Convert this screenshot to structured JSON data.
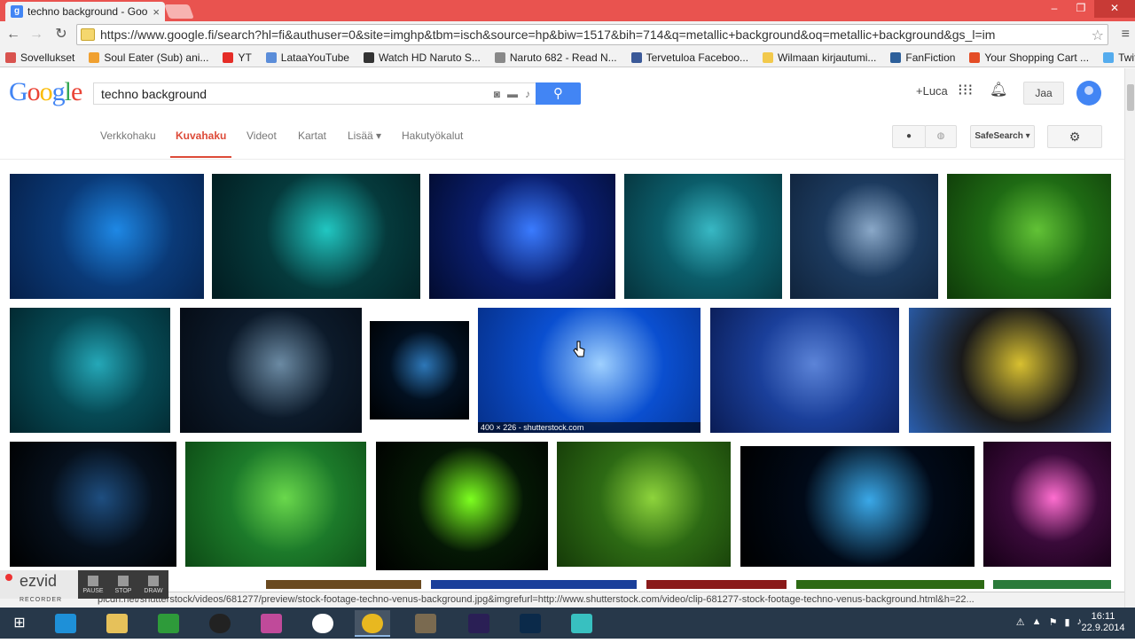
{
  "browser": {
    "tab_title": "techno background - Goo",
    "tab_close": "×",
    "window_buttons": [
      "–",
      "❐",
      "✕"
    ],
    "url": "https://www.google.fi/search?hl=fi&authuser=0&site=imghp&tbm=isch&source=hp&biw=1517&bih=714&q=metallic+background&oq=metallic+background&gs_l=im",
    "bookmarks": [
      {
        "label": "Sovellukset",
        "color": "#d9534f"
      },
      {
        "label": "Soul Eater (Sub) ani...",
        "color": "#f0a030"
      },
      {
        "label": "YT",
        "color": "#e52d27"
      },
      {
        "label": "LataaYouTube",
        "color": "#5b8dd9"
      },
      {
        "label": "Watch HD Naruto S...",
        "color": "#333333"
      },
      {
        "label": "Naruto 682 - Read N...",
        "color": "#888888"
      },
      {
        "label": "Tervetuloa Faceboo...",
        "color": "#3b5998"
      },
      {
        "label": "Wilmaan kirjautumi...",
        "color": "#f2c94c"
      },
      {
        "label": "FanFiction",
        "color": "#2d5f9a"
      },
      {
        "label": "Your Shopping Cart ...",
        "color": "#e44d26"
      },
      {
        "label": "Twitter",
        "color": "#55acee"
      }
    ]
  },
  "google": {
    "logo_letters": [
      "G",
      "o",
      "o",
      "g",
      "l",
      "e"
    ],
    "search_query": "techno background",
    "plus_user": "+Luca",
    "share_label": "Jaa",
    "tabs": [
      {
        "label": "Verkkohaku",
        "active": false
      },
      {
        "label": "Kuvahaku",
        "active": true
      },
      {
        "label": "Videot",
        "active": false
      },
      {
        "label": "Kartat",
        "active": false
      },
      {
        "label": "Lisää ▾",
        "active": false
      },
      {
        "label": "Hakutyökalut",
        "active": false
      }
    ],
    "safesearch_label": "SafeSearch ▾",
    "accent_color": "#4285f4",
    "active_tab_color": "#dd4b39"
  },
  "images": {
    "hover_caption": "400 × 226 - shutterstock.com",
    "rows": [
      [
        {
          "name": "blue-tech-circles",
          "colors": [
            "#0a3a78",
            "#1e88e5",
            "#06204a"
          ]
        },
        {
          "name": "teal-gear-circuit",
          "colors": [
            "#053a3c",
            "#21c7c2",
            "#021c20"
          ]
        },
        {
          "name": "blue-speed-rings",
          "colors": [
            "#0a1e6e",
            "#3a7bff",
            "#020b2e"
          ]
        },
        {
          "name": "teal-circle-grid",
          "colors": [
            "#0b5d6a",
            "#38b8c4",
            "#06323b"
          ]
        },
        {
          "name": "brushed-metal-blue",
          "colors": [
            "#1c3a5e",
            "#8aa8c8",
            "#10233b"
          ]
        },
        {
          "name": "green-circuit-board",
          "colors": [
            "#1f6b14",
            "#62c236",
            "#0f3a09"
          ]
        }
      ],
      [
        {
          "name": "teal-binary-grid",
          "colors": [
            "#064a55",
            "#25a8b8",
            "#02252c"
          ]
        },
        {
          "name": "dark-circuit-lines",
          "colors": [
            "#0c1a2a",
            "#6b8aa3",
            "#050b14"
          ]
        },
        {
          "name": "blue-maze-squares",
          "colors": [
            "#021020",
            "#2d77b8",
            "#000000"
          ]
        },
        {
          "name": "blue-tunnel-rings",
          "colors": [
            "#0a4fd0",
            "#9ed0ff",
            "#06308a"
          ]
        },
        {
          "name": "blue-hex-mesh",
          "colors": [
            "#1a3f9a",
            "#5c84d8",
            "#0a1c55"
          ]
        },
        {
          "name": "rainbow-dots-diagonal",
          "colors": [
            "#1a1a1a",
            "#d8c030",
            "#2a5fb0"
          ]
        }
      ],
      [
        {
          "name": "dark-blue-maze",
          "colors": [
            "#06101c",
            "#1e4e80",
            "#000000"
          ]
        },
        {
          "name": "green-motherboard",
          "colors": [
            "#1c7a2a",
            "#6ad84c",
            "#0d4a15"
          ]
        },
        {
          "name": "green-light-bars",
          "colors": [
            "#051805",
            "#7dff20",
            "#000000"
          ]
        },
        {
          "name": "green-circuit-traces",
          "colors": [
            "#2d6a14",
            "#8ed43c",
            "#153a08"
          ]
        },
        {
          "name": "blue-light-burst",
          "colors": [
            "#010a18",
            "#3aa8e8",
            "#000000"
          ]
        },
        {
          "name": "pink-explosion",
          "colors": [
            "#3a0a3a",
            "#ff6ed0",
            "#150015"
          ]
        }
      ]
    ]
  },
  "status": {
    "link_text": "picdn.net/shutterstock/videos/681277/preview/stock-footage-techno-venus-background.jpg&imgrefurl=http://www.shutterstock.com/video/clip-681277-stock-footage-techno-venus-background.html&h=22..."
  },
  "recorder": {
    "logo": "ezvid",
    "subtitle": "RECORDER",
    "buttons": [
      "PAUSE",
      "STOP",
      "DRAW"
    ]
  },
  "taskbar": {
    "time": "16:11",
    "date": "22.9.2014"
  }
}
